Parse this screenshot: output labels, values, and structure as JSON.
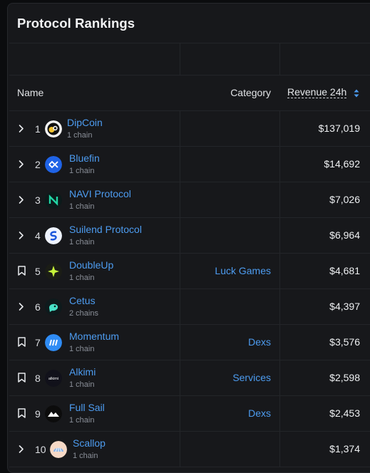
{
  "panel": {
    "title": "Protocol Rankings"
  },
  "header": {
    "name": "Name",
    "category": "Category",
    "revenue": "Revenue 24h"
  },
  "rows": [
    {
      "rank": "1",
      "name": "DipCoin",
      "chains": "1 chain",
      "category": "",
      "revenue": "$137,019",
      "action": "expand",
      "logo": "dipcoin-logo"
    },
    {
      "rank": "2",
      "name": "Bluefin",
      "chains": "1 chain",
      "category": "",
      "revenue": "$14,692",
      "action": "expand",
      "logo": "bluefin-logo"
    },
    {
      "rank": "3",
      "name": "NAVI Protocol",
      "chains": "1 chain",
      "category": "",
      "revenue": "$7,026",
      "action": "expand",
      "logo": "navi-logo"
    },
    {
      "rank": "4",
      "name": "Suilend Protocol",
      "chains": "1 chain",
      "category": "",
      "revenue": "$6,964",
      "action": "expand",
      "logo": "suilend-logo"
    },
    {
      "rank": "5",
      "name": "DoubleUp",
      "chains": "1 chain",
      "category": "Luck Games",
      "revenue": "$4,681",
      "action": "bookmark",
      "logo": "doubleup-logo"
    },
    {
      "rank": "6",
      "name": "Cetus",
      "chains": "2 chains",
      "category": "",
      "revenue": "$4,397",
      "action": "expand",
      "logo": "cetus-logo"
    },
    {
      "rank": "7",
      "name": "Momentum",
      "chains": "1 chain",
      "category": "Dexs",
      "revenue": "$3,576",
      "action": "bookmark",
      "logo": "momentum-logo"
    },
    {
      "rank": "8",
      "name": "Alkimi",
      "chains": "1 chain",
      "category": "Services",
      "revenue": "$2,598",
      "action": "bookmark",
      "logo": "alkimi-logo"
    },
    {
      "rank": "9",
      "name": "Full Sail",
      "chains": "1 chain",
      "category": "Dexs",
      "revenue": "$2,453",
      "action": "bookmark",
      "logo": "fullsail-logo"
    },
    {
      "rank": "10",
      "name": "Scallop",
      "chains": "1 chain",
      "category": "",
      "revenue": "$1,374",
      "action": "expand",
      "logo": "scallop-logo"
    }
  ],
  "logo_texts": {
    "alkimi": "alkimi"
  },
  "colors": {
    "link": "#4d9cf0",
    "panel": "#17181b",
    "border": "#232529"
  }
}
